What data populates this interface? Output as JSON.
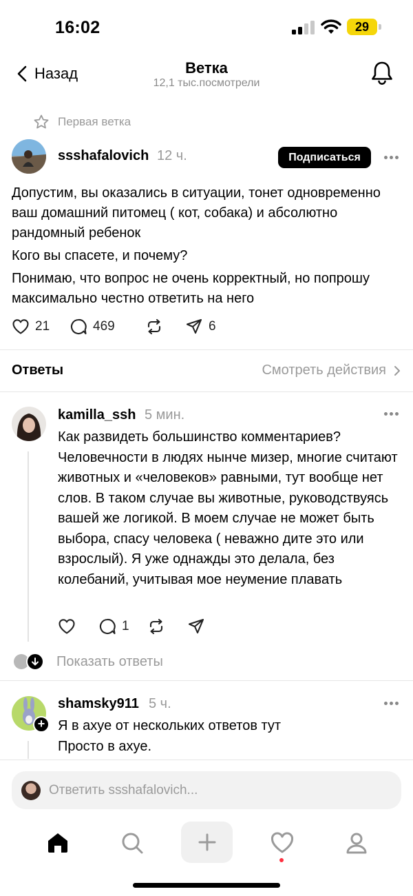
{
  "status_bar": {
    "time": "16:02",
    "battery": "29"
  },
  "header": {
    "back_label": "Назад",
    "title": "Ветка",
    "subtitle": "12,1 тыс.посмотрели"
  },
  "first_thread_label": "Первая ветка",
  "post": {
    "username": "ssshafalovich",
    "time": "12 ч.",
    "subscribe_label": "Подписаться",
    "paragraphs": [
      "Допустим, вы оказались в ситуации, тонет одновременно ваш домашний питомец ( кот, собака) и абсолютно рандомный ребенок",
      "Кого вы спасете, и почему?",
      "Понимаю, что вопрос не очень корректный, но попрошу максимально честно ответить на него"
    ],
    "likes": "21",
    "comments": "469",
    "shares": "6"
  },
  "answers": {
    "title": "Ответы",
    "view_activity": "Смотреть действия"
  },
  "replies": [
    {
      "username": "kamilla_ssh",
      "time": "5 мин.",
      "text": "Как развидеть большинство комментариев? Человечности в людях нынче мизер, многие считают животных и «человеков» равными, тут вообще нет слов. В таком случае вы животные, руководствуясь вашей же логикой. В моем случае не может быть выбора, спасу человека ( неважно дите это или взрослый). Я уже однажды это делала, без колебаний, учитывая мое неумение плавать",
      "comments": "1"
    },
    {
      "username": "shamsky911",
      "time": "5 ч.",
      "lines": [
        "Я в ахуе от нескольких ответов тут",
        "Просто в ахуе."
      ]
    }
  ],
  "show_replies_label": "Показать ответы",
  "composer_placeholder": "Ответить ssshafalovich...",
  "colors": {
    "subscribe_bg": "#000000",
    "battery": "#f5d60a",
    "notification_dot": "#ff3040",
    "muted_text": "#9a9a9a"
  }
}
